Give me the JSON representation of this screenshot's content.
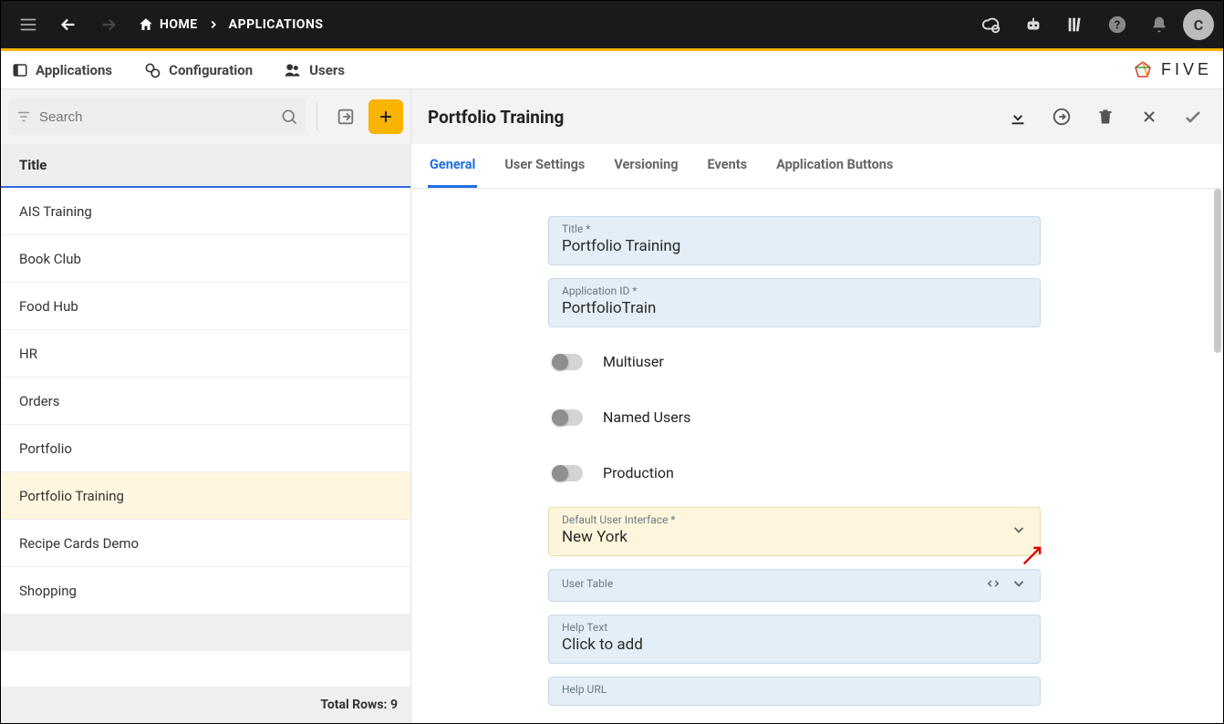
{
  "header": {
    "home": "HOME",
    "applications": "APPLICATIONS",
    "avatar_initial": "C"
  },
  "subnav": {
    "applications": "Applications",
    "configuration": "Configuration",
    "users": "Users",
    "brand": "FIVE"
  },
  "sidebar": {
    "search_placeholder": "Search",
    "header": "Title",
    "rows": [
      "AIS Training",
      "Book Club",
      "Food Hub",
      "HR",
      "Orders",
      "Portfolio",
      "Portfolio Training",
      "Recipe Cards Demo",
      "Shopping"
    ],
    "selected_index": 6,
    "footer_label": "Total Rows:",
    "footer_count": "9"
  },
  "detail": {
    "title": "Portfolio Training",
    "tabs": [
      "General",
      "User Settings",
      "Versioning",
      "Events",
      "Application Buttons"
    ],
    "active_tab": 0,
    "fields": {
      "title_label": "Title *",
      "title_value": "Portfolio Training",
      "appid_label": "Application ID *",
      "appid_value": "PortfolioTrain",
      "toggle_multiuser": "Multiuser",
      "toggle_named": "Named Users",
      "toggle_production": "Production",
      "dui_label": "Default User Interface *",
      "dui_value": "New York",
      "user_table_label": "User Table",
      "help_text_label": "Help Text",
      "help_text_value": "Click to add",
      "help_url_label": "Help URL"
    }
  }
}
